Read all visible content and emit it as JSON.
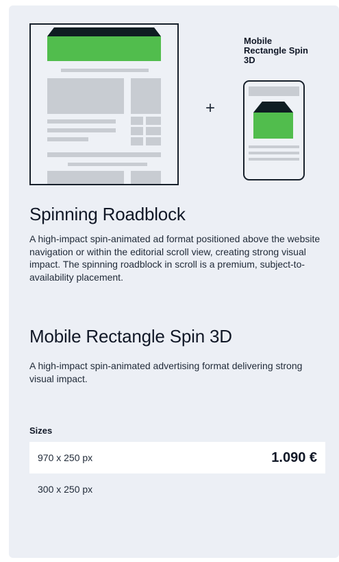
{
  "illustration": {
    "plus_sign": "+",
    "mobile_label": "Mobile Rectangle Spin 3D"
  },
  "products": [
    {
      "title": "Spinning Roadblock",
      "description": "A high-impact spin-animated ad format positioned above the website navigation or within the editorial scroll view, creating strong visual impact. The spinning roadblock in scroll is a premium, subject-to-availability placement."
    },
    {
      "title": "Mobile Rectangle Spin 3D",
      "description": "A high-impact spin-animated advertising format delivering strong visual impact."
    }
  ],
  "sizes": {
    "label": "Sizes",
    "rows": [
      {
        "size": "970 x 250 px",
        "price": "1.090 €"
      },
      {
        "size": "300 x 250 px",
        "price": ""
      }
    ]
  },
  "colors": {
    "card_background": "#eceff5",
    "ad_green": "#51bd4d",
    "ad_dark": "#0f1d22",
    "placeholder_gray": "#c8ccd2"
  }
}
